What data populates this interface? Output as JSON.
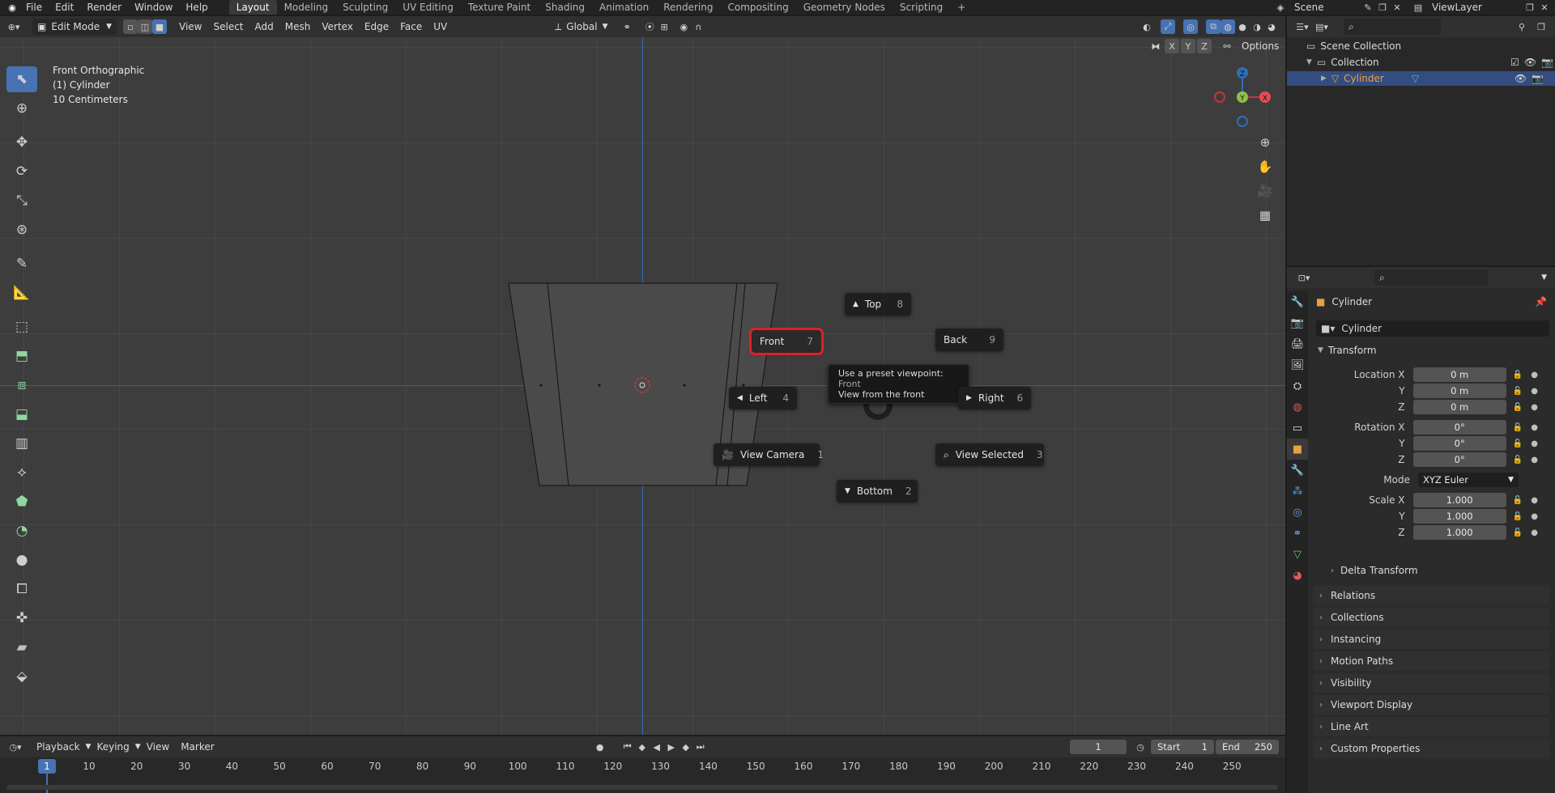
{
  "topbar": {
    "menus": [
      "File",
      "Edit",
      "Render",
      "Window",
      "Help"
    ],
    "workspaces": [
      "Layout",
      "Modeling",
      "Sculpting",
      "UV Editing",
      "Texture Paint",
      "Shading",
      "Animation",
      "Rendering",
      "Compositing",
      "Geometry Nodes",
      "Scripting"
    ],
    "active_workspace": "Layout",
    "scene": "Scene",
    "view_layer": "ViewLayer"
  },
  "viewport_header": {
    "mode": "Edit Mode",
    "menus": [
      "View",
      "Select",
      "Add",
      "Mesh",
      "Vertex",
      "Edge",
      "Face",
      "UV"
    ],
    "transform_orientation": "Global",
    "axes": [
      "X",
      "Y",
      "Z"
    ],
    "options": "Options"
  },
  "viewport": {
    "view_name": "Front Orthographic",
    "object_line": "(1) Cylinder",
    "scale": "10 Centimeters",
    "gizmo": {
      "z": "Z",
      "y": "Y",
      "x": "X"
    }
  },
  "pie_menu": {
    "top": {
      "label": "Top",
      "key": "8"
    },
    "front": {
      "label": "Front",
      "key": "7"
    },
    "back": {
      "label": "Back",
      "key": "9"
    },
    "left": {
      "label": "Left",
      "key": "4"
    },
    "right": {
      "label": "Right",
      "key": "6"
    },
    "view_camera": {
      "label": "View Camera",
      "key": "1"
    },
    "view_selected": {
      "label": "View Selected",
      "key": "3"
    },
    "bottom": {
      "label": "Bottom",
      "key": "2"
    },
    "tooltip_line1": "Use a preset viewpoint:",
    "tooltip_value": "Front",
    "tooltip_line2": "View from the front"
  },
  "outliner": {
    "root": "Scene Collection",
    "collection": "Collection",
    "object": "Cylinder"
  },
  "properties": {
    "object_name": "Cylinder",
    "data_name": "Cylinder",
    "transform_label": "Transform",
    "location": {
      "label_x": "Location X",
      "x": "0 m",
      "y": "0 m",
      "z": "0 m"
    },
    "rotation": {
      "label_x": "Rotation X",
      "x": "0°",
      "y": "0°",
      "z": "0°"
    },
    "mode_label": "Mode",
    "mode_value": "XYZ Euler",
    "scale": {
      "label_x": "Scale X",
      "x": "1.000",
      "y": "1.000",
      "z": "1.000"
    },
    "axis_y": "Y",
    "axis_z": "Z",
    "delta_transform": "Delta Transform",
    "panels": [
      "Relations",
      "Collections",
      "Instancing",
      "Motion Paths",
      "Visibility",
      "Viewport Display",
      "Line Art",
      "Custom Properties"
    ]
  },
  "timeline": {
    "menus": [
      "Playback",
      "Keying",
      "View",
      "Marker"
    ],
    "current_frame": "1",
    "start_label": "Start",
    "start": "1",
    "end_label": "End",
    "end": "250",
    "frame_marker": "1",
    "ticks": [
      "10",
      "20",
      "30",
      "40",
      "50",
      "60",
      "70",
      "80",
      "90",
      "100",
      "110",
      "120",
      "130",
      "140",
      "150",
      "160",
      "170",
      "180",
      "190",
      "200",
      "210",
      "220",
      "230",
      "240",
      "250"
    ]
  },
  "colors": {
    "accent": "#4772b3",
    "highlight_box": "#e01e2a",
    "x_axis": "#c8323c",
    "y_axis_line": "#2f6fb3",
    "object_orange": "#e8a041"
  }
}
